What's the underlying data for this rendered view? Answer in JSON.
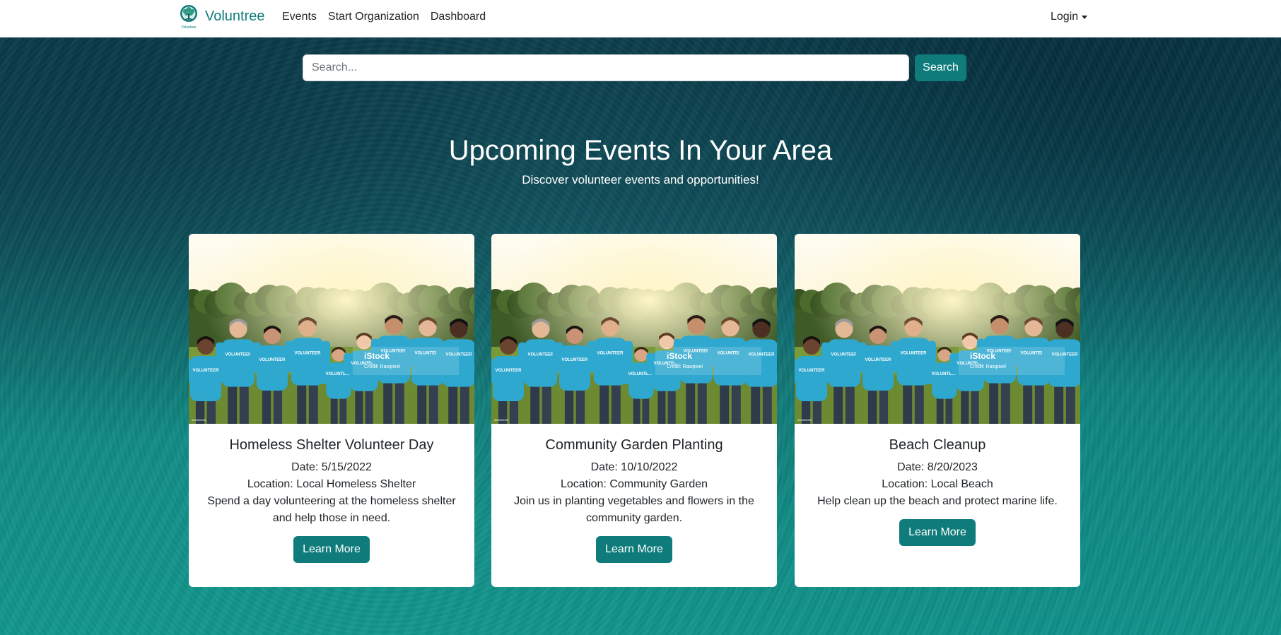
{
  "nav": {
    "brand": "Voluntree",
    "logo_caption": "Voluntree",
    "links": [
      "Events",
      "Start Organization",
      "Dashboard"
    ],
    "login": "Login"
  },
  "search": {
    "placeholder": "Search...",
    "button": "Search"
  },
  "hero": {
    "title": "Upcoming Events In Your Area",
    "subtitle": "Discover volunteer events and opportunities!"
  },
  "events": [
    {
      "title": "Homeless Shelter Volunteer Day",
      "date": "Date: 5/15/2022",
      "location": "Location: Local Homeless Shelter",
      "description": "Spend a day volunteering at the homeless shelter and help those in need.",
      "button": "Learn More"
    },
    {
      "title": "Community Garden Planting",
      "date": "Date: 10/10/2022",
      "location": "Location: Community Garden",
      "description": "Join us in planting vegetables and flowers in the community garden.",
      "button": "Learn More"
    },
    {
      "title": "Beach Cleanup",
      "date": "Date: 8/20/2023",
      "location": "Location: Local Beach",
      "description": "Help clean up the beach and protect marine life.",
      "button": "Learn More"
    }
  ],
  "image": {
    "shirt_text": "VOLUNTEER",
    "watermark": "iStock",
    "credit": "Credit: Rawpixel",
    "stock_id": "000000000"
  },
  "colors": {
    "accent": "#0f7b7b",
    "shirt": "#2fa8d0",
    "nav_bg": "#ffffff"
  },
  "icons": {
    "logo": "tree-logo-icon",
    "dropdown": "caret-down-icon"
  }
}
